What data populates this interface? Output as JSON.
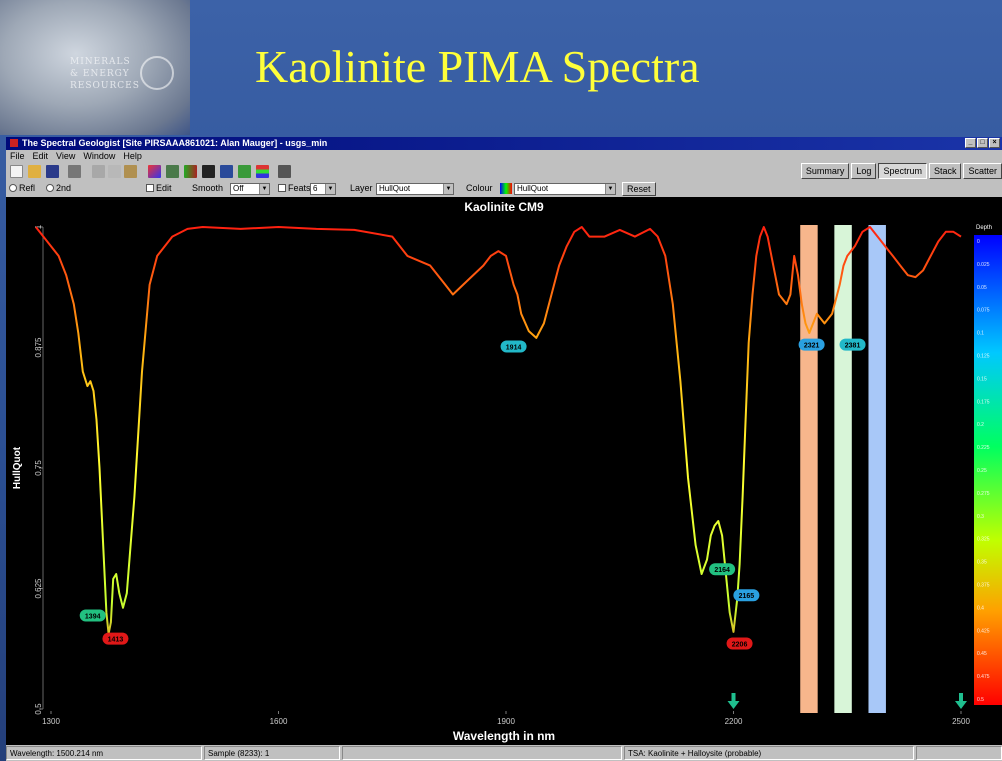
{
  "slide": {
    "title": "Kaolinite PIMA Spectra",
    "logo_lines": [
      "MINERALS",
      "& ENERGY",
      "RESOURCES"
    ]
  },
  "window": {
    "title": "The Spectral Geologist [Site PIRSAAA861021: Alan Mauger] - usgs_min",
    "controls": [
      "_",
      "□",
      "×"
    ]
  },
  "menu": [
    "File",
    "Edit",
    "View",
    "Window",
    "Help"
  ],
  "view_tabs": [
    {
      "label": "Summary",
      "active": false
    },
    {
      "label": "Log",
      "active": false
    },
    {
      "label": "Spectrum",
      "active": true
    },
    {
      "label": "Stack",
      "active": false
    },
    {
      "label": "Scatter",
      "active": false
    }
  ],
  "toolbar": {
    "refl": "Refl",
    "second": "2nd",
    "edit": "Edit",
    "smooth_label": "Smooth",
    "smooth_value": "Off",
    "feats_label": "Feats",
    "feats_value": "6",
    "layer_label": "Layer",
    "layer_value": "HullQuot",
    "colour_label": "Colour",
    "colour_value": "HullQuot",
    "reset": "Reset"
  },
  "status": {
    "wavelength": "Wavelength: 1500.214 nm",
    "sample": "Sample (8233): 1",
    "tsa": "TSA: Kaolinite + Halloysite (probable)"
  },
  "colors": {
    "slide_bg": "#2b4f93",
    "title": "#ffff3a",
    "plot_bg": "#000000",
    "band_orange": "#f7b68c",
    "band_green": "#d8f5d8",
    "band_blue": "#a8c8f8",
    "arrow": "#1fbf8f"
  },
  "chart_data": {
    "type": "line",
    "title": "Kaolinite CM9",
    "xlabel": "Wavelength in nm",
    "ylabel": "HullQuot",
    "xlim": [
      1300,
      2500
    ],
    "ylim": [
      0.5,
      1
    ],
    "xticks": [
      1300,
      1600,
      1900,
      2200,
      2500
    ],
    "xtick_labels": [
      "1300",
      "1600",
      "1900",
      "2200",
      "2500"
    ],
    "yticks": [
      0.5,
      0.625,
      0.75,
      0.875,
      1
    ],
    "ytick_labels": [
      "0.5",
      "0.625",
      "0.75",
      "0.875",
      "1"
    ],
    "grid": false,
    "series": [
      {
        "x": [
          1280,
          1290,
          1300,
          1310,
          1320,
          1330,
          1336,
          1342,
          1348,
          1352,
          1356,
          1360,
          1364,
          1367,
          1370,
          1373,
          1376,
          1379,
          1382,
          1386,
          1390,
          1395,
          1400,
          1410,
          1420,
          1430,
          1440,
          1460,
          1480,
          1500,
          1550,
          1600,
          1650,
          1700,
          1750,
          1770,
          1800,
          1820,
          1830,
          1850,
          1870,
          1880,
          1890,
          1900,
          1910,
          1915,
          1920,
          1930,
          1940,
          1950,
          1960,
          1970,
          1980,
          1990,
          2000,
          2010,
          2030,
          2050,
          2070,
          2090,
          2100,
          2110,
          2120,
          2130,
          2140,
          2150,
          2158,
          2165,
          2170,
          2175,
          2180,
          2185,
          2190,
          2195,
          2200,
          2205,
          2208,
          2212,
          2216,
          2220,
          2225,
          2230,
          2235,
          2240,
          2245,
          2250,
          2255,
          2260,
          2265,
          2270,
          2275,
          2280,
          2285,
          2290,
          2295,
          2300,
          2310,
          2320,
          2330,
          2340,
          2345,
          2350,
          2360,
          2370,
          2380,
          2390,
          2400,
          2410,
          2420,
          2430,
          2440,
          2450,
          2460,
          2470,
          2480,
          2490,
          2500
        ],
        "y": [
          1.0,
          0.99,
          0.98,
          0.97,
          0.95,
          0.92,
          0.89,
          0.85,
          0.835,
          0.84,
          0.83,
          0.8,
          0.75,
          0.7,
          0.65,
          0.6,
          0.578,
          0.59,
          0.635,
          0.64,
          0.62,
          0.605,
          0.62,
          0.72,
          0.85,
          0.94,
          0.97,
          0.99,
          0.998,
          1.0,
          0.998,
          1.0,
          0.998,
          0.997,
          0.99,
          0.97,
          0.96,
          0.94,
          0.93,
          0.945,
          0.96,
          0.97,
          0.975,
          0.97,
          0.94,
          0.93,
          0.91,
          0.892,
          0.885,
          0.9,
          0.93,
          0.96,
          0.98,
          0.995,
          1.0,
          0.99,
          0.99,
          0.997,
          0.99,
          0.998,
          0.99,
          0.97,
          0.92,
          0.84,
          0.74,
          0.67,
          0.64,
          0.655,
          0.68,
          0.69,
          0.695,
          0.68,
          0.64,
          0.6,
          0.58,
          0.615,
          0.65,
          0.72,
          0.8,
          0.88,
          0.93,
          0.97,
          0.99,
          1.0,
          0.99,
          0.97,
          0.95,
          0.93,
          0.925,
          0.92,
          0.93,
          0.97,
          0.95,
          0.92,
          0.9,
          0.89,
          0.91,
          0.9,
          0.91,
          0.94,
          0.96,
          0.97,
          0.98,
          0.995,
          1.0,
          0.99,
          0.98,
          0.97,
          0.96,
          0.95,
          0.948,
          0.955,
          0.97,
          0.985,
          0.995,
          0.995,
          0.99
        ]
      }
    ],
    "feature_labels": [
      {
        "x": 1355,
        "y": 0.597,
        "text": "1394",
        "color": "#22c080"
      },
      {
        "x": 1385,
        "y": 0.573,
        "text": "1413",
        "color": "#e01818"
      },
      {
        "x": 1910,
        "y": 0.876,
        "text": "1914",
        "color": "#22b8c8"
      },
      {
        "x": 2185,
        "y": 0.645,
        "text": "2164",
        "color": "#22c080"
      },
      {
        "x": 2217,
        "y": 0.618,
        "text": "2165",
        "color": "#2aa0e0"
      },
      {
        "x": 2208,
        "y": 0.568,
        "text": "2206",
        "color": "#e01818"
      },
      {
        "x": 2303,
        "y": 0.878,
        "text": "2321",
        "color": "#2aa0e0"
      },
      {
        "x": 2357,
        "y": 0.878,
        "text": "2381",
        "color": "#22b8c8"
      }
    ],
    "bands": [
      {
        "x": [
          2288,
          2311
        ],
        "color": "#f7b68c"
      },
      {
        "x": [
          2333,
          2356
        ],
        "color": "#d8f5d8"
      },
      {
        "x": [
          2378,
          2401
        ],
        "color": "#a8c8f8"
      }
    ],
    "arrows_x": [
      2200,
      2500
    ],
    "colorbar": {
      "title": "Depth",
      "labels": [
        "0",
        "0.025",
        "0.05",
        "0.075",
        "0.1",
        "0.125",
        "0.15",
        "0.175",
        "0.2",
        "0.225",
        "0.25",
        "0.275",
        "0.3",
        "0.325",
        "0.35",
        "0.375",
        "0.4",
        "0.425",
        "0.45",
        "0.475",
        "0.5"
      ]
    }
  }
}
